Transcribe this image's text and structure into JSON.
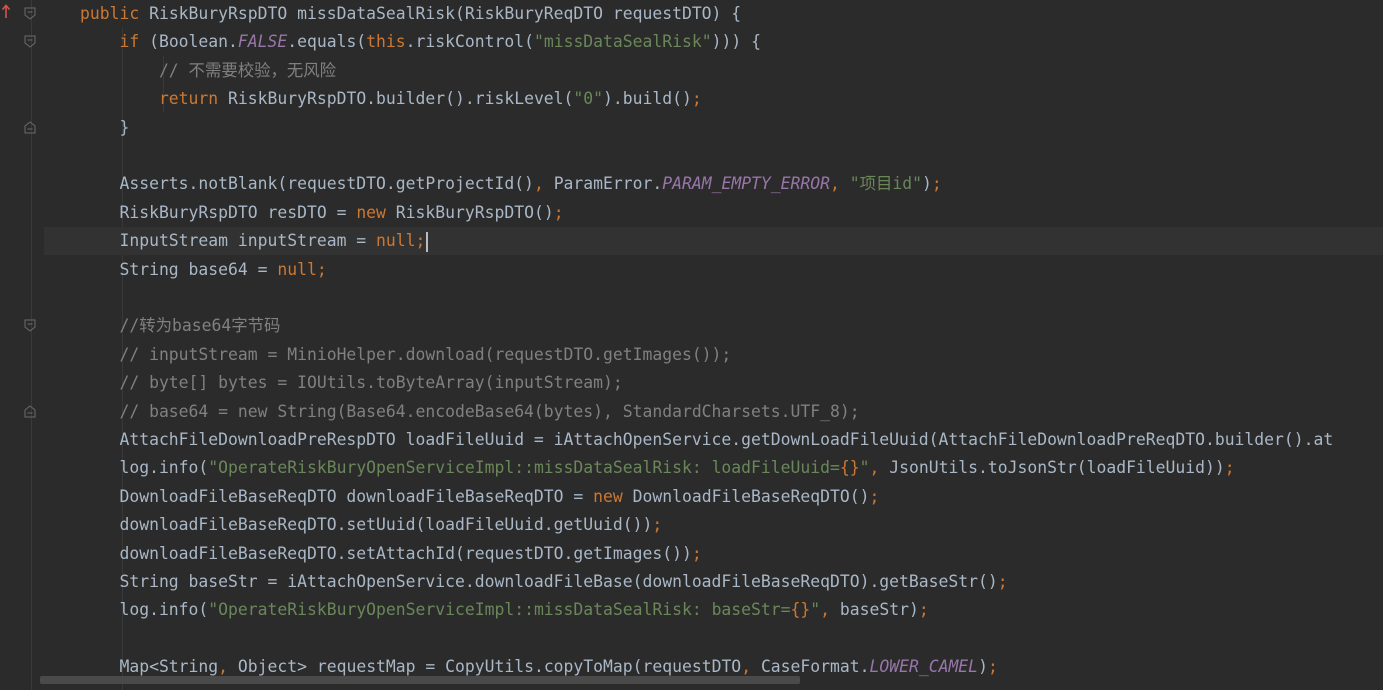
{
  "editor": {
    "lines": [
      [
        {
          "t": "public ",
          "c": "kw"
        },
        {
          "t": "RiskBuryRspDTO missDataSealRisk(RiskBuryReqDTO requestDTO) {"
        }
      ],
      [
        {
          "t": "    if ",
          "c": "kw"
        },
        {
          "t": "(Boolean."
        },
        {
          "t": "FALSE",
          "c": "fld"
        },
        {
          "t": ".equals("
        },
        {
          "t": "this",
          "c": "kw"
        },
        {
          "t": ".riskControl("
        },
        {
          "t": "\"missDataSealRisk\"",
          "c": "str"
        },
        {
          "t": "))) {"
        }
      ],
      [
        {
          "t": "        // 不需要校验，无风险",
          "c": "cm"
        }
      ],
      [
        {
          "t": "        return ",
          "c": "kw"
        },
        {
          "t": "RiskBuryRspDTO.builder().riskLevel("
        },
        {
          "t": "\"0\"",
          "c": "str"
        },
        {
          "t": ").build()"
        },
        {
          "t": ";",
          "c": "kw"
        }
      ],
      [
        {
          "t": "    }"
        }
      ],
      [],
      [
        {
          "t": "    Asserts.notBlank(requestDTO.getProjectId()"
        },
        {
          "t": ", ",
          "c": "kw"
        },
        {
          "t": "ParamError."
        },
        {
          "t": "PARAM_EMPTY_ERROR",
          "c": "fld"
        },
        {
          "t": ", ",
          "c": "kw"
        },
        {
          "t": "\"项目id\"",
          "c": "str"
        },
        {
          "t": ")"
        },
        {
          "t": ";",
          "c": "kw"
        }
      ],
      [
        {
          "t": "    RiskBuryRspDTO resDTO = "
        },
        {
          "t": "new ",
          "c": "kw"
        },
        {
          "t": "RiskBuryRspDTO()"
        },
        {
          "t": ";",
          "c": "kw"
        }
      ],
      [
        {
          "t": "    InputStream inputStream = "
        },
        {
          "t": "null;",
          "c": "kw"
        }
      ],
      [
        {
          "t": "    String base64 = "
        },
        {
          "t": "null;",
          "c": "kw"
        }
      ],
      [],
      [
        {
          "t": "    //转为base64字节码",
          "c": "cm"
        }
      ],
      [
        {
          "t": "    // inputStream = MinioHelper.download(requestDTO.getImages());",
          "c": "cm"
        }
      ],
      [
        {
          "t": "    // byte[] bytes = IOUtils.toByteArray(inputStream);",
          "c": "cm"
        }
      ],
      [
        {
          "t": "    // base64 = new String(Base64.encodeBase64(bytes), StandardCharsets.UTF_8);",
          "c": "cm"
        }
      ],
      [
        {
          "t": "    AttachFileDownloadPreRespDTO loadFileUuid = iAttachOpenService.getDownLoadFileUuid(AttachFileDownloadPreReqDTO.builder().at"
        }
      ],
      [
        {
          "t": "    log.info("
        },
        {
          "t": "\"OperateRiskBuryOpenServiceImpl::missDataSealRisk: loadFileUuid=",
          "c": "str"
        },
        {
          "t": "{}",
          "c": "kw"
        },
        {
          "t": "\"",
          "c": "str"
        },
        {
          "t": ", ",
          "c": "kw"
        },
        {
          "t": "JsonUtils.toJsonStr(loadFileUuid))"
        },
        {
          "t": ";",
          "c": "kw"
        }
      ],
      [
        {
          "t": "    DownloadFileBaseReqDTO downloadFileBaseReqDTO = "
        },
        {
          "t": "new ",
          "c": "kw"
        },
        {
          "t": "DownloadFileBaseReqDTO()"
        },
        {
          "t": ";",
          "c": "kw"
        }
      ],
      [
        {
          "t": "    downloadFileBaseReqDTO.setUuid(loadFileUuid.getUuid())"
        },
        {
          "t": ";",
          "c": "kw"
        }
      ],
      [
        {
          "t": "    downloadFileBaseReqDTO.setAttachId(requestDTO.getImages())"
        },
        {
          "t": ";",
          "c": "kw"
        }
      ],
      [
        {
          "t": "    String baseStr = iAttachOpenService.downloadFileBase(downloadFileBaseReqDTO).getBaseStr()"
        },
        {
          "t": ";",
          "c": "kw"
        }
      ],
      [
        {
          "t": "    log.info("
        },
        {
          "t": "\"OperateRiskBuryOpenServiceImpl::missDataSealRisk: baseStr=",
          "c": "str"
        },
        {
          "t": "{}",
          "c": "kw"
        },
        {
          "t": "\"",
          "c": "str"
        },
        {
          "t": ", ",
          "c": "kw"
        },
        {
          "t": "baseStr)"
        },
        {
          "t": ";",
          "c": "kw"
        }
      ],
      [],
      [
        {
          "t": "    Map<String"
        },
        {
          "t": ", ",
          "c": "kw"
        },
        {
          "t": "Object> requestMap = CopyUtils.copyToMap(requestDTO"
        },
        {
          "t": ", ",
          "c": "kw"
        },
        {
          "t": "CaseFormat."
        },
        {
          "t": "LOWER_CAMEL",
          "c": "fld"
        },
        {
          "t": ")"
        },
        {
          "t": ";",
          "c": "kw"
        }
      ]
    ],
    "current_line": 8,
    "fold_markers": [
      {
        "line": 0,
        "kind": "open"
      },
      {
        "line": 1,
        "kind": "open"
      },
      {
        "line": 4,
        "kind": "close"
      },
      {
        "line": 11,
        "kind": "open"
      },
      {
        "line": 14,
        "kind": "close"
      }
    ],
    "override_marker_icon": "override-arrow-icon"
  }
}
